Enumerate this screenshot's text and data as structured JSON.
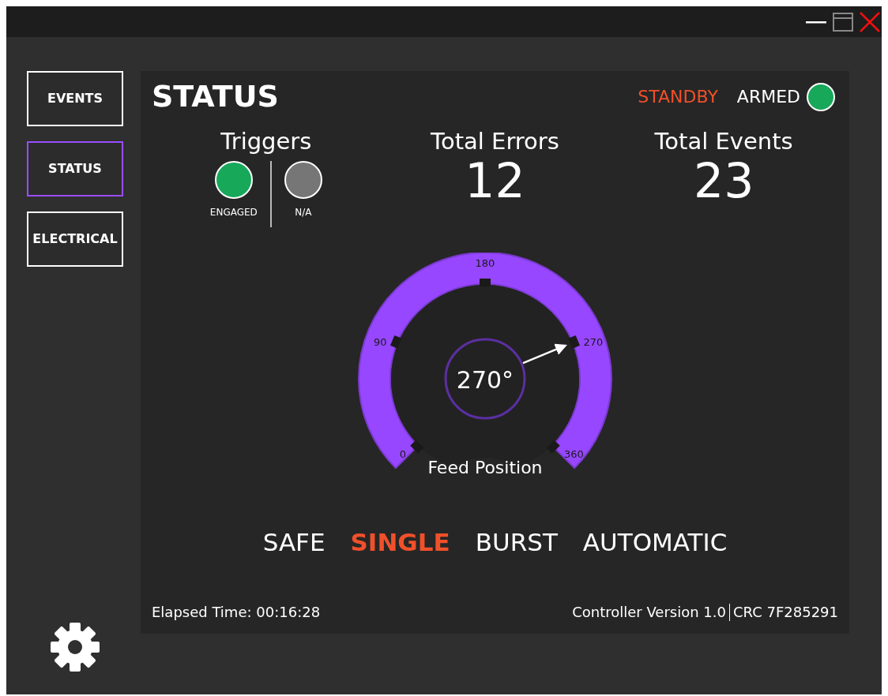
{
  "nav": [
    {
      "label": "EVENTS",
      "selected": false
    },
    {
      "label": "STATUS",
      "selected": true
    },
    {
      "label": "ELECTRICAL",
      "selected": false
    }
  ],
  "status": {
    "title": "STATUS",
    "mode": "STANDBY",
    "armed": {
      "label": "ARMED",
      "color": "#17a85a"
    }
  },
  "triggers": {
    "title": "Triggers",
    "items": [
      {
        "label": "ENGAGED",
        "color": "#17a85a"
      },
      {
        "label": "N/A",
        "color": "#767676"
      }
    ]
  },
  "stats": [
    {
      "label": "Total Errors",
      "value": "12"
    },
    {
      "label": "Total Events",
      "value": "23"
    }
  ],
  "gauge": {
    "ticks": [
      "0",
      "90",
      "180",
      "270",
      "360"
    ],
    "reading": "270°",
    "label": "Feed Position"
  },
  "modes": [
    {
      "label": "SAFE",
      "selected": false
    },
    {
      "label": "SINGLE",
      "selected": true
    },
    {
      "label": "BURST",
      "selected": false
    },
    {
      "label": "AUTOMATIC",
      "selected": false
    }
  ],
  "footer": {
    "elapsed": "Elapsed Time: 00:16:28",
    "version": "Controller Version 1.0",
    "crc": "CRC 7F285291"
  }
}
